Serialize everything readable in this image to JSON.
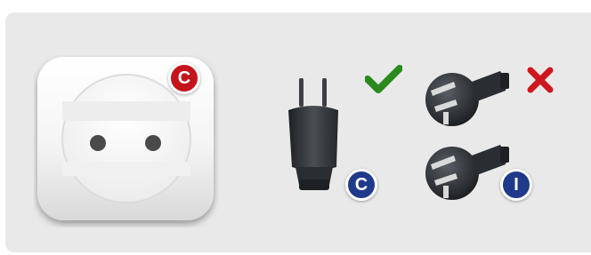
{
  "socket": {
    "type_letter": "C",
    "badge_color": "#c4151c"
  },
  "plugs": [
    {
      "type_letter": "C",
      "compatible": true,
      "status_icon": "check-icon",
      "badge_color": "#1f3a8a"
    },
    {
      "type_letter": "I",
      "compatible": false,
      "status_icon": "cross-icon",
      "badge_color": "#1f3a8a"
    }
  ],
  "colors": {
    "panel": "#e9e9e9",
    "compatible": "#2a8a1e",
    "incompatible": "#d0161e"
  }
}
